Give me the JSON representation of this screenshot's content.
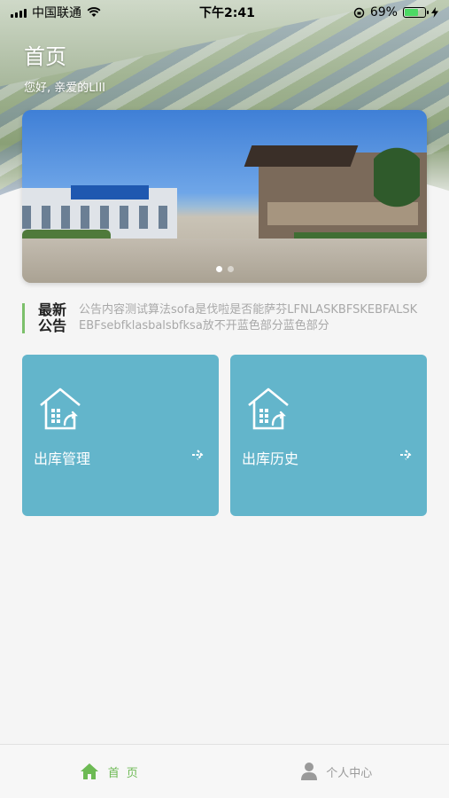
{
  "status_bar": {
    "carrier": "中国联通",
    "time": "下午2:41",
    "battery": "69%"
  },
  "header": {
    "title": "首页",
    "greeting": "您好, 亲爱的LIII"
  },
  "banner": {
    "slide_count": 2,
    "active_slide": 1
  },
  "notice": {
    "label_line1": "最新",
    "label_line2": "公告",
    "content": "公告内容测试算法sofa是伐啦是否能萨芬LFNLASKBFSKEBFALSKEBFsebfklasbalsbfksa放不开蓝色部分蓝色部分"
  },
  "cards": [
    {
      "label": "出库管理",
      "icon": "warehouse-icon"
    },
    {
      "label": "出库历史",
      "icon": "warehouse-icon"
    }
  ],
  "tabbar": {
    "items": [
      {
        "label": "首页",
        "icon": "home-icon",
        "active": true
      },
      {
        "label": "个人中心",
        "icon": "person-icon",
        "active": false
      }
    ]
  },
  "colors": {
    "accent": "#6dba54",
    "card": "#63b5cb",
    "background": "#f5f5f5"
  }
}
